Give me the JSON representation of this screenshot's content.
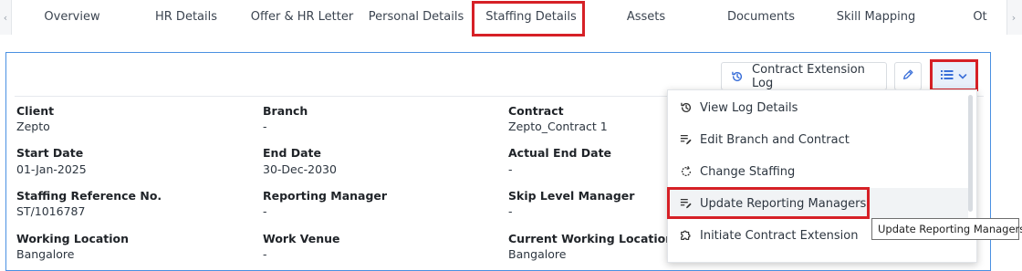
{
  "tabs": [
    {
      "label": "Overview"
    },
    {
      "label": "HR Details"
    },
    {
      "label": "Offer & HR Letter"
    },
    {
      "label": "Personal Details"
    },
    {
      "label": "Staffing Details"
    },
    {
      "label": "Assets"
    },
    {
      "label": "Documents"
    },
    {
      "label": "Skill Mapping"
    },
    {
      "label": "Ot"
    }
  ],
  "active_tab": "Staffing Details",
  "toolbar": {
    "contract_log_label": "Contract Extension Log"
  },
  "fields": {
    "client": {
      "label": "Client",
      "value": "Zepto"
    },
    "branch": {
      "label": "Branch",
      "value": "-"
    },
    "contract": {
      "label": "Contract",
      "value": "Zepto_Contract 1"
    },
    "start_date": {
      "label": "Start Date",
      "value": "01-Jan-2025"
    },
    "end_date": {
      "label": "End Date",
      "value": "30-Dec-2030"
    },
    "actual_end_date": {
      "label": "Actual End Date",
      "value": "-"
    },
    "staffing_ref": {
      "label": "Staffing Reference No.",
      "value": "ST/1016787"
    },
    "reporting_manager": {
      "label": "Reporting Manager",
      "value": "-"
    },
    "skip_level_manager": {
      "label": "Skip Level Manager",
      "value": "-"
    },
    "working_location": {
      "label": "Working Location",
      "value": "Bangalore"
    },
    "work_venue": {
      "label": "Work Venue",
      "value": "-"
    },
    "current_working_location": {
      "label": "Current Working Location",
      "value": "Bangalore"
    }
  },
  "menu": {
    "items": [
      {
        "label": "View Log Details",
        "icon": "history-icon"
      },
      {
        "label": "Edit Branch and Contract",
        "icon": "edit-list-icon"
      },
      {
        "label": "Change Staffing",
        "icon": "refresh-icon"
      },
      {
        "label": "Update Reporting Managers",
        "icon": "edit-list-icon"
      },
      {
        "label": "Initiate Contract Extension",
        "icon": "puzzle-icon"
      }
    ]
  },
  "tooltip": {
    "text": "Update Reporting Managers"
  },
  "colors": {
    "highlight": "#d62026",
    "panel_border": "#4a90e2",
    "accent": "#3a6fd8"
  }
}
